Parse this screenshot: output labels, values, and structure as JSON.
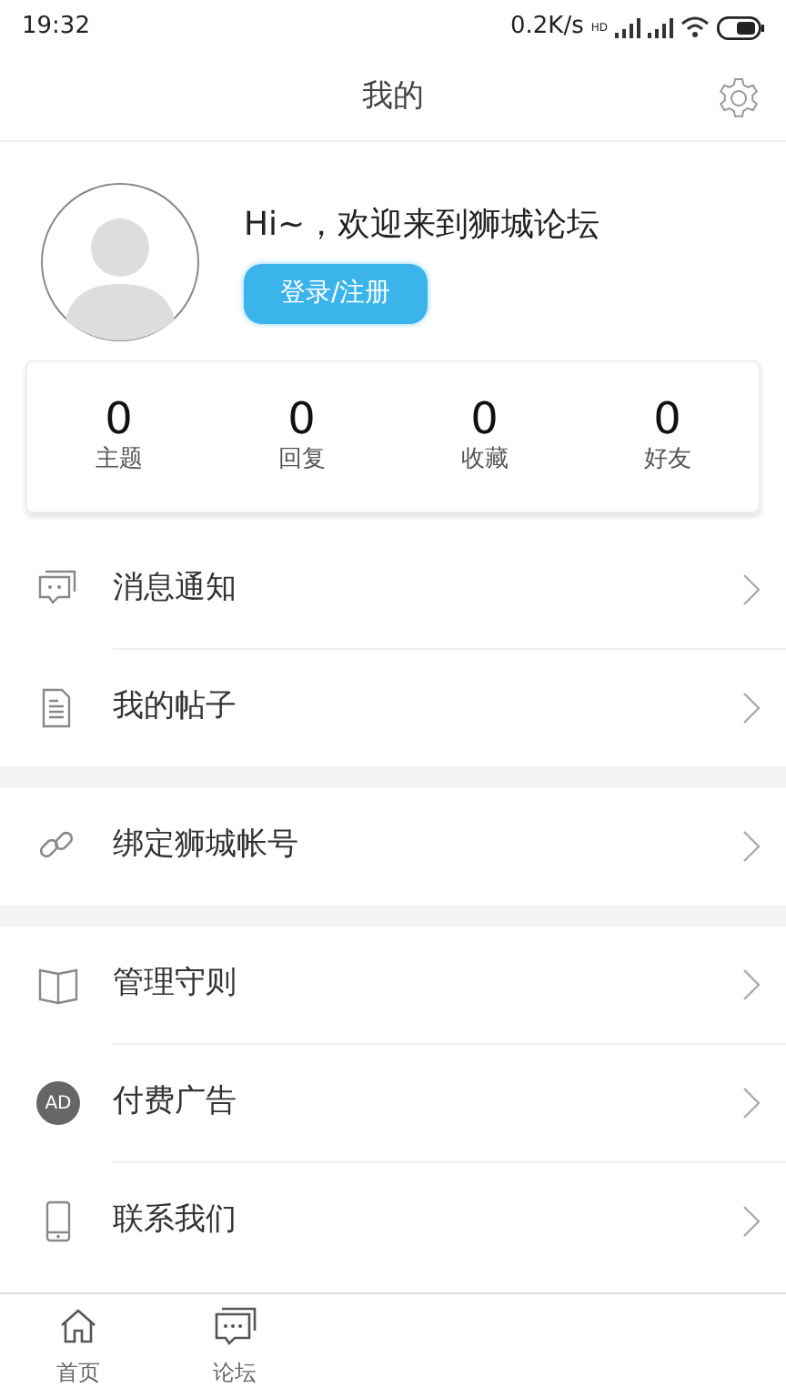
{
  "status_bar": {
    "time": "19:32",
    "speed": "0.2K/s",
    "hd": "HD"
  },
  "header": {
    "title": "我的"
  },
  "profile": {
    "greeting": "Hi~，欢迎来到狮城论坛",
    "login_button": "登录/注册"
  },
  "stats": [
    {
      "value": "0",
      "label": "主题"
    },
    {
      "value": "0",
      "label": "回复"
    },
    {
      "value": "0",
      "label": "收藏"
    },
    {
      "value": "0",
      "label": "好友"
    }
  ],
  "menu_groups": [
    [
      {
        "kind": "message",
        "label": "消息通知"
      },
      {
        "kind": "document",
        "label": "我的帖子"
      }
    ],
    [
      {
        "kind": "link",
        "label": "绑定狮城帐号"
      }
    ],
    [
      {
        "kind": "book",
        "label": "管理守则"
      },
      {
        "kind": "ad",
        "label": "付费广告",
        "icon_text": "AD"
      },
      {
        "kind": "phone",
        "label": "联系我们"
      }
    ]
  ],
  "tab_bar": [
    {
      "kind": "home",
      "label": "首页"
    },
    {
      "kind": "forum",
      "label": "论坛"
    }
  ]
}
